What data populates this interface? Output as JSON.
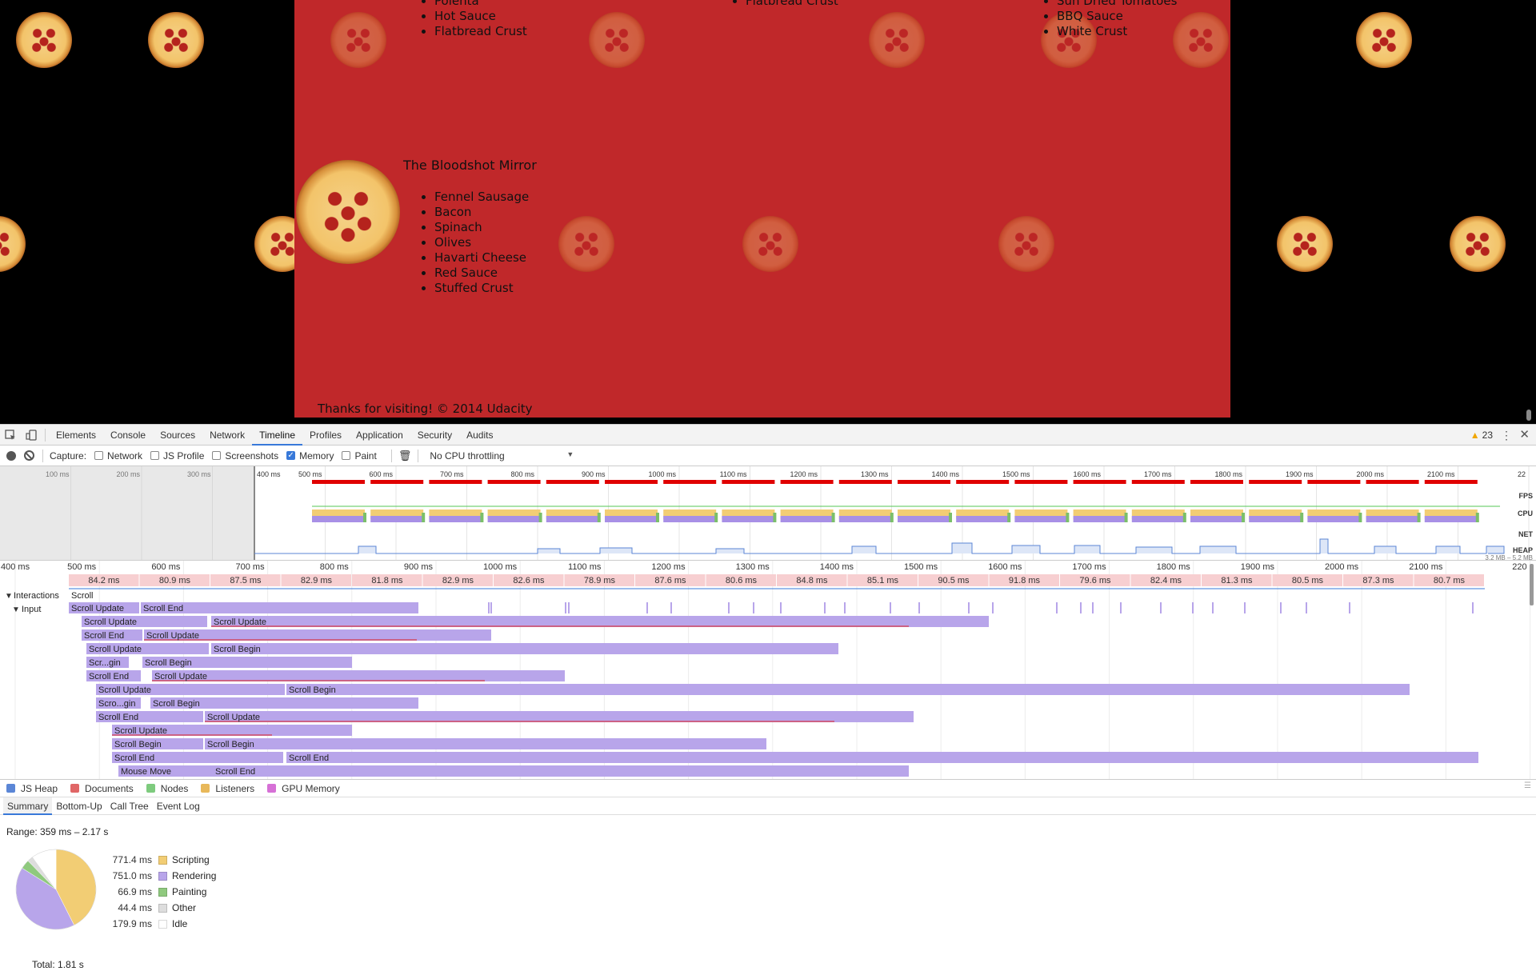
{
  "page": {
    "top_list_left": [
      "Polenta",
      "Hot Sauce",
      "Flatbread Crust"
    ],
    "top_list_mid": [
      "Flatbread Crust"
    ],
    "top_list_right": [
      "Sun Dried Tomatoes",
      "BBQ Sauce",
      "White Crust"
    ],
    "pizza_title": "The Bloodshot Mirror",
    "ingredients": [
      "Fennel Sausage",
      "Bacon",
      "Spinach",
      "Olives",
      "Havarti Cheese",
      "Red Sauce",
      "Stuffed Crust"
    ],
    "footer": "Thanks for visiting! © 2014 Udacity"
  },
  "devtools": {
    "tabs": [
      "Elements",
      "Console",
      "Sources",
      "Network",
      "Timeline",
      "Profiles",
      "Application",
      "Security",
      "Audits"
    ],
    "active_tab": "Timeline",
    "warnings_count": "23",
    "capture": {
      "label": "Capture:",
      "options": [
        {
          "label": "Network",
          "checked": false
        },
        {
          "label": "JS Profile",
          "checked": false
        },
        {
          "label": "Screenshots",
          "checked": false
        },
        {
          "label": "Memory",
          "checked": true
        },
        {
          "label": "Paint",
          "checked": false
        }
      ],
      "throttling": "No CPU throttling"
    },
    "overview": {
      "left_ticks": [
        "100 ms",
        "200 ms",
        "300 ms"
      ],
      "ticks": [
        "400 ms",
        "500 ms",
        "600 ms",
        "700 ms",
        "800 ms",
        "900 ms",
        "1000 ms",
        "1100 ms",
        "1200 ms",
        "1300 ms",
        "1400 ms",
        "1500 ms",
        "1600 ms",
        "1700 ms",
        "1800 ms",
        "1900 ms",
        "2000 ms",
        "2100 ms",
        "22"
      ],
      "track_labels": [
        "FPS",
        "CPU",
        "NET",
        "HEAP"
      ],
      "heap_range": "3.2 MB – 5.2 MB"
    },
    "flame": {
      "ticks": [
        "400 ms",
        "500 ms",
        "600 ms",
        "700 ms",
        "800 ms",
        "900 ms",
        "1000 ms",
        "1100 ms",
        "1200 ms",
        "1300 ms",
        "1400 ms",
        "1500 ms",
        "1600 ms",
        "1700 ms",
        "1800 ms",
        "1900 ms",
        "2000 ms",
        "2100 ms",
        "220"
      ],
      "frames": [
        "84.2 ms",
        "80.9 ms",
        "87.5 ms",
        "82.9 ms",
        "81.8 ms",
        "82.9 ms",
        "82.6 ms",
        "78.9 ms",
        "87.6 ms",
        "80.6 ms",
        "84.8 ms",
        "85.1 ms",
        "90.5 ms",
        "91.8 ms",
        "79.6 ms",
        "82.4 ms",
        "81.3 ms",
        "80.5 ms",
        "87.3 ms",
        "80.7 ms"
      ],
      "interactions_label": "Interactions",
      "interactions_value": "Scroll",
      "input_label": "Input",
      "rows": [
        [
          {
            "t": "Scroll Update",
            "s": 0,
            "e": 88
          },
          {
            "t": "Scroll End",
            "s": 90,
            "e": 437
          }
        ],
        [
          {
            "t": "Scroll Update",
            "s": 16,
            "e": 173
          },
          {
            "t": "Scroll Update",
            "s": 178,
            "e": 1150,
            "line": 1050
          }
        ],
        [
          {
            "t": "Scroll End",
            "s": 16,
            "e": 92
          },
          {
            "t": "Scroll Update",
            "s": 94,
            "e": 528,
            "line": 435
          }
        ],
        [
          {
            "t": "Scroll Update",
            "s": 22,
            "e": 175
          },
          {
            "t": "Scroll Begin",
            "s": 178,
            "e": 962
          }
        ],
        [
          {
            "t": "Scr...gin",
            "s": 22,
            "e": 75
          },
          {
            "t": "Scroll Begin",
            "s": 92,
            "e": 354
          }
        ],
        [
          {
            "t": "Scroll End",
            "s": 22,
            "e": 90
          },
          {
            "t": "Scroll Update",
            "s": 104,
            "e": 620,
            "line": 520
          }
        ],
        [
          {
            "t": "Scroll Update",
            "s": 34,
            "e": 270
          },
          {
            "t": "Scroll Begin",
            "s": 272,
            "e": 1676
          }
        ],
        [
          {
            "t": "Scro...gin",
            "s": 34,
            "e": 90
          },
          {
            "t": "Scroll Begin",
            "s": 102,
            "e": 437
          }
        ],
        [
          {
            "t": "Scroll End",
            "s": 34,
            "e": 168
          },
          {
            "t": "Scroll Update",
            "s": 170,
            "e": 1056,
            "line": 957
          }
        ],
        [
          {
            "t": "Scroll Update",
            "s": 54,
            "e": 354,
            "line": 254
          }
        ],
        [
          {
            "t": "Scroll Begin",
            "s": 54,
            "e": 168
          },
          {
            "t": "Scroll Begin",
            "s": 170,
            "e": 872
          }
        ],
        [
          {
            "t": "Scroll End",
            "s": 54,
            "e": 268
          },
          {
            "t": "Scroll End",
            "s": 272,
            "e": 1762
          }
        ],
        [
          {
            "t": "Mouse Move",
            "s": 62,
            "e": 180
          },
          {
            "t": "Scroll End",
            "s": 180,
            "e": 1050
          }
        ]
      ]
    },
    "legend": [
      {
        "label": "JS Heap",
        "color": "#5b86d6"
      },
      {
        "label": "Documents",
        "color": "#e06666"
      },
      {
        "label": "Nodes",
        "color": "#7ecb7e"
      },
      {
        "label": "Listeners",
        "color": "#e8b85a"
      },
      {
        "label": "GPU Memory",
        "color": "#d670d6"
      }
    ],
    "detail_tabs": [
      "Summary",
      "Bottom-Up",
      "Call Tree",
      "Event Log"
    ],
    "summary": {
      "range": "Range: 359 ms – 2.17 s",
      "items": [
        {
          "value": "771.4 ms",
          "label": "Scripting",
          "color": "#f2cd74",
          "ms": 771.4
        },
        {
          "value": "751.0 ms",
          "label": "Rendering",
          "color": "#b8a5ea",
          "ms": 751.0
        },
        {
          "value": "66.9 ms",
          "label": "Painting",
          "color": "#8fc97e",
          "ms": 66.9
        },
        {
          "value": "44.4 ms",
          "label": "Other",
          "color": "#dddddd",
          "ms": 44.4
        },
        {
          "value": "179.9 ms",
          "label": "Idle",
          "color": "#ffffff",
          "ms": 179.9
        }
      ],
      "total": "Total: 1.81 s"
    }
  }
}
